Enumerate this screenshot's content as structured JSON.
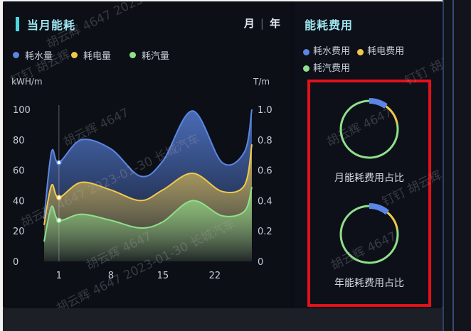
{
  "energy_panel": {
    "title": "当月能耗",
    "period_month": "月",
    "period_year": "年",
    "legend": [
      {
        "label": "耗水量",
        "color": "#5b86e5"
      },
      {
        "label": "耗电量",
        "color": "#f1c94a"
      },
      {
        "label": "耗汽量",
        "color": "#8fe08a"
      }
    ],
    "left_unit": "kWH/m",
    "right_unit": "T/m"
  },
  "chart_data": {
    "type": "area",
    "x_ticks": [
      "1",
      "8",
      "15",
      "22"
    ],
    "y_left_ticks": [
      "100",
      "80",
      "60",
      "40",
      "20",
      "0"
    ],
    "y_right_ticks": [
      "1.0",
      "0.8",
      "0.6",
      "0.4",
      "0.2",
      "0"
    ],
    "ylim_left": [
      0,
      100
    ],
    "ylim_right": [
      0,
      1.0
    ],
    "x": [
      -1,
      0,
      1,
      4,
      8,
      12,
      15,
      19,
      23,
      26,
      27
    ],
    "series": [
      {
        "name": "耗水量",
        "color": "#5b86e5",
        "values": [
          28,
          72,
          65,
          80,
          74,
          56,
          66,
          99,
          65,
          72,
          100
        ]
      },
      {
        "name": "耗电量",
        "color": "#f1c94a",
        "values": [
          24,
          50,
          42,
          52,
          47,
          40,
          47,
          58,
          46,
          50,
          77
        ]
      },
      {
        "name": "耗汽量",
        "color": "#8fe08a",
        "values": [
          13,
          36,
          27,
          31,
          27,
          22,
          26,
          40,
          30,
          33,
          49
        ]
      }
    ],
    "marker_x": 1,
    "grid": false
  },
  "cost_panel": {
    "title": "能耗费用",
    "legend": [
      {
        "label": "耗水费用",
        "color": "#5b86e5"
      },
      {
        "label": "耗电费用",
        "color": "#f1c94a"
      },
      {
        "label": "耗汽费用",
        "color": "#8fe08a"
      }
    ],
    "rings": [
      {
        "label": "月能耗费用占比",
        "shares": [
          0.1,
          0.12,
          0.78
        ]
      },
      {
        "label": "年能耗费用占比",
        "shares": [
          0.11,
          0.11,
          0.78
        ]
      }
    ]
  },
  "watermark": {
    "text": "胡云辉 4647 2023-01-30 长城汽车",
    "short": "胡云辉 4647",
    "dingding": "钉钉 胡云辉"
  }
}
